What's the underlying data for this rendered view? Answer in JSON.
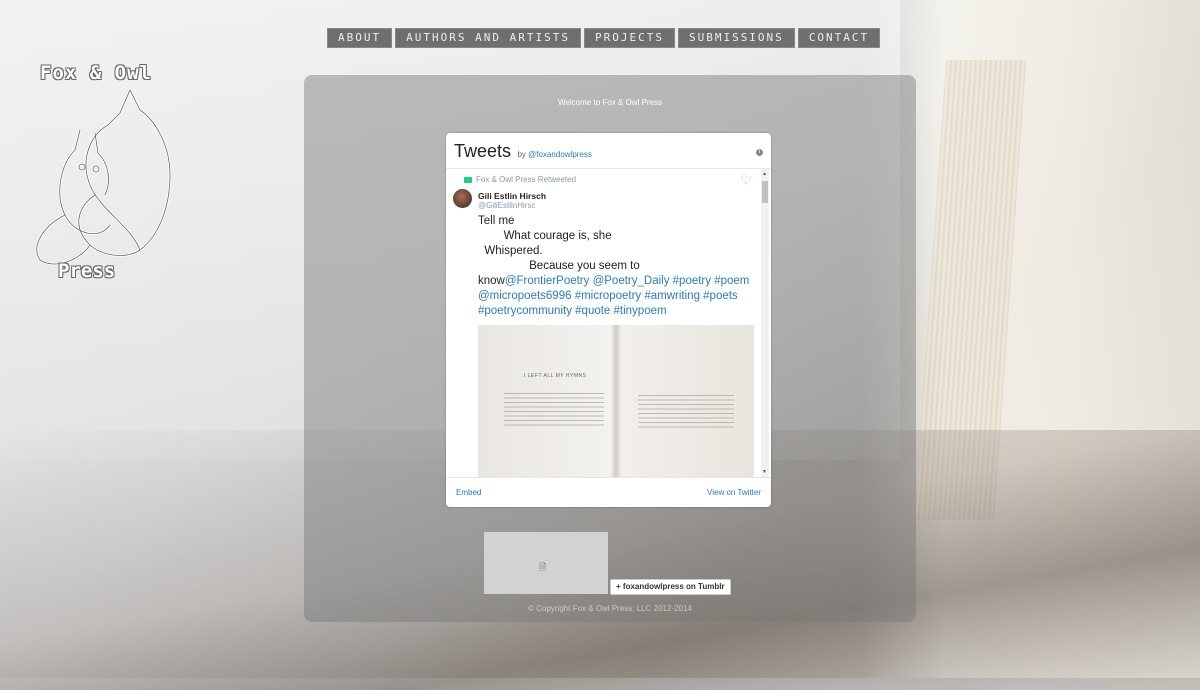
{
  "nav": {
    "items": [
      {
        "label": "ABOUT"
      },
      {
        "label": "AUTHORS AND ARTISTS"
      },
      {
        "label": "PROJECTS"
      },
      {
        "label": "SUBMISSIONS"
      },
      {
        "label": "CONTACT"
      }
    ]
  },
  "logo": {
    "top": "Fox & Owl",
    "bottom": "Press"
  },
  "main": {
    "welcome": "Welcome to Fox & Owl Press"
  },
  "twitter": {
    "title": "Tweets",
    "by": "by",
    "handle": "@foxandowlpress",
    "retweeted": "Fox & Owl Press Retweeted",
    "tweet": {
      "author_name": "Gili Estlin Hirsch",
      "author_handle": "@GiliEstlinHirsc",
      "line1": "Tell me",
      "line2": "        What courage is, she",
      "line3": "  Whispered.",
      "line4": "                Because you seem to",
      "line5_prefix": "know",
      "line5_links": "@FrontierPoetry @Poetry_Daily #poetry #poem @micropoets6996 #micropoetry #amwriting #poets #poetrycommunity #quote #tinypoem",
      "media_heading": "I LEFT ALL MY HYMNS"
    },
    "embed": "Embed",
    "view": "View on Twitter",
    "accent": "#2b7bb9"
  },
  "tumblr": {
    "label": "foxandowlpress on Tumblr",
    "plus": "+"
  },
  "footer": {
    "copyright": "© Copyright Fox & Owl Press, LLC 2012-2014"
  }
}
